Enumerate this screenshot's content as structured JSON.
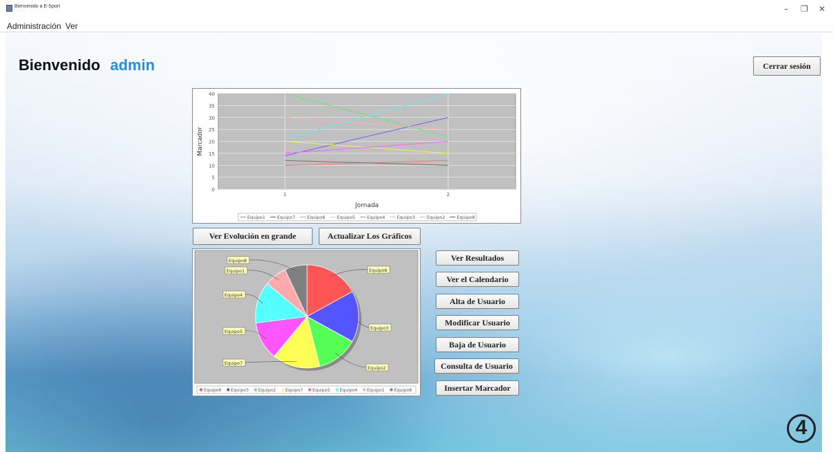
{
  "window": {
    "title": "Bienvenido a E-Sport",
    "minimize": "–",
    "maximize": "❐",
    "close": "✕"
  },
  "menu": [
    "Administración",
    "Ver"
  ],
  "header": {
    "welcome": "Bienvenido",
    "username": "admin",
    "logout_label": "Cerrar sesión"
  },
  "buttons": {
    "view_evolution": "Ver Evolución en grande",
    "refresh_charts": "Actualizar Los Gráficos",
    "actions": [
      "Ver Resultados",
      "Ver el Calendario",
      "Alta de Usuario",
      "Modificar Usuario",
      "Baja de Usuario",
      "Consulta de Usuario",
      "Insertar Marcador"
    ]
  },
  "logo_text": "4",
  "chart_data": [
    {
      "type": "line",
      "title": "",
      "xlabel": "Jornada",
      "ylabel": "Marcador",
      "x": [
        1,
        2
      ],
      "ylim": [
        0,
        40
      ],
      "yticks": [
        0,
        5,
        10,
        15,
        20,
        25,
        30,
        35,
        40
      ],
      "xticks": [
        1,
        2
      ],
      "grid": true,
      "legend_position": "bottom",
      "series": [
        {
          "name": "Equipo1",
          "values": [
            10,
            12
          ],
          "color": "#ff7070"
        },
        {
          "name": "Equipo7",
          "values": [
            14,
            30
          ],
          "color": "#6060ff"
        },
        {
          "name": "Equipo6",
          "values": [
            40,
            22
          ],
          "color": "#70e070"
        },
        {
          "name": "Equipo5",
          "values": [
            20,
            15
          ],
          "color": "#f0f050"
        },
        {
          "name": "Equipo4",
          "values": [
            15,
            20
          ],
          "color": "#ff60ff"
        },
        {
          "name": "Equipo3",
          "values": [
            21,
            40
          ],
          "color": "#60f0f0"
        },
        {
          "name": "Equipo2",
          "values": [
            30,
            25
          ],
          "color": "#ffb0b0"
        },
        {
          "name": "Equipo8",
          "values": [
            12,
            10
          ],
          "color": "#707070"
        }
      ]
    },
    {
      "type": "pie",
      "title": "",
      "legend_position": "bottom",
      "slices": [
        {
          "label": "Equipo6",
          "value": 17,
          "color": "#ff5555"
        },
        {
          "label": "Equipo3",
          "value": 16,
          "color": "#5555ff"
        },
        {
          "label": "Equipo2",
          "value": 13,
          "color": "#55ff55"
        },
        {
          "label": "Equipo7",
          "value": 15,
          "color": "#ffff55"
        },
        {
          "label": "Equipo5",
          "value": 12,
          "color": "#ff55ff"
        },
        {
          "label": "Equipo4",
          "value": 13,
          "color": "#55ffff"
        },
        {
          "label": "Equipo1",
          "value": 7,
          "color": "#ffaaaa"
        },
        {
          "label": "Equipo8",
          "value": 7,
          "color": "#808080"
        }
      ]
    }
  ]
}
